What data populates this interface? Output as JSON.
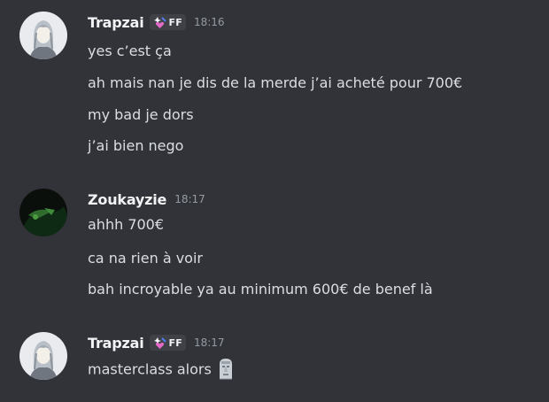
{
  "messages": [
    {
      "username": "Trapzai",
      "tag": "FF",
      "tag_icon": "sparkle-heart-icon",
      "timestamp": "18:16",
      "lines": [
        "yes c’est ça",
        "ah mais nan je dis de la merde j’ai acheté pour 700€",
        "my bad je dors",
        "j’ai bien nego"
      ]
    },
    {
      "username": "Zoukayzie",
      "timestamp": "18:17",
      "lines": [
        "ahhh 700€",
        "ca na rien à voir",
        "bah incroyable ya au minimum 600€ de benef là"
      ]
    },
    {
      "username": "Trapzai",
      "tag": "FF",
      "tag_icon": "sparkle-heart-icon",
      "timestamp": "18:17",
      "lines": [
        "masterclass alors"
      ],
      "emoji": "moai-icon"
    }
  ],
  "colors": {
    "background": "#313338",
    "username": "#f2f3f5",
    "text": "#dbdee1",
    "timestamp": "#949ba4",
    "tag_bg": "#3f4147"
  }
}
